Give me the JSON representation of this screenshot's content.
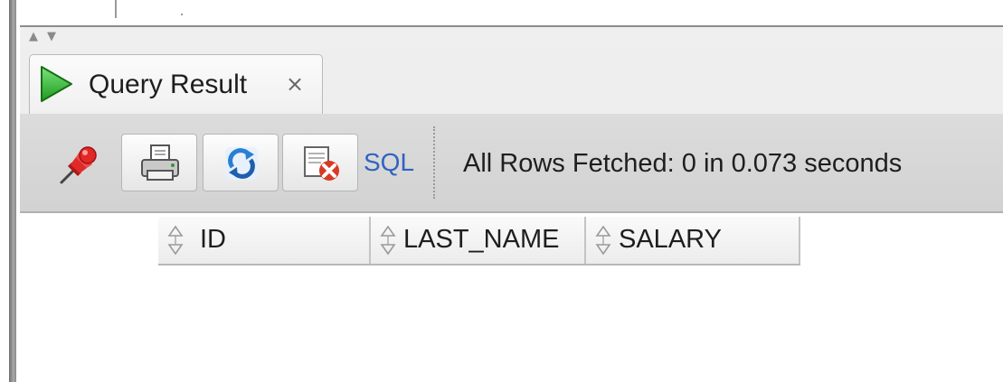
{
  "tab": {
    "title": "Query Result",
    "close_glyph": "×",
    "icon": "run-play-icon"
  },
  "splitter": {
    "up_glyph": "▲",
    "down_glyph": "▼"
  },
  "toolbar": {
    "buttons": [
      {
        "name": "pin",
        "icon": "pushpin-icon"
      },
      {
        "name": "print",
        "icon": "printer-icon"
      },
      {
        "name": "refresh",
        "icon": "refresh-icon"
      },
      {
        "name": "clear",
        "icon": "clear-delete-icon"
      }
    ],
    "sql_label": "SQL",
    "status": "All Rows Fetched: 0 in 0.073 seconds"
  },
  "grid": {
    "columns": [
      "ID",
      "LAST_NAME",
      "SALARY"
    ],
    "rows": []
  },
  "colors": {
    "play_green": "#2fbf2f",
    "pin_red": "#d42020",
    "sql_blue": "#2f64c0",
    "toolbar_bg": "#d8d8d8"
  }
}
